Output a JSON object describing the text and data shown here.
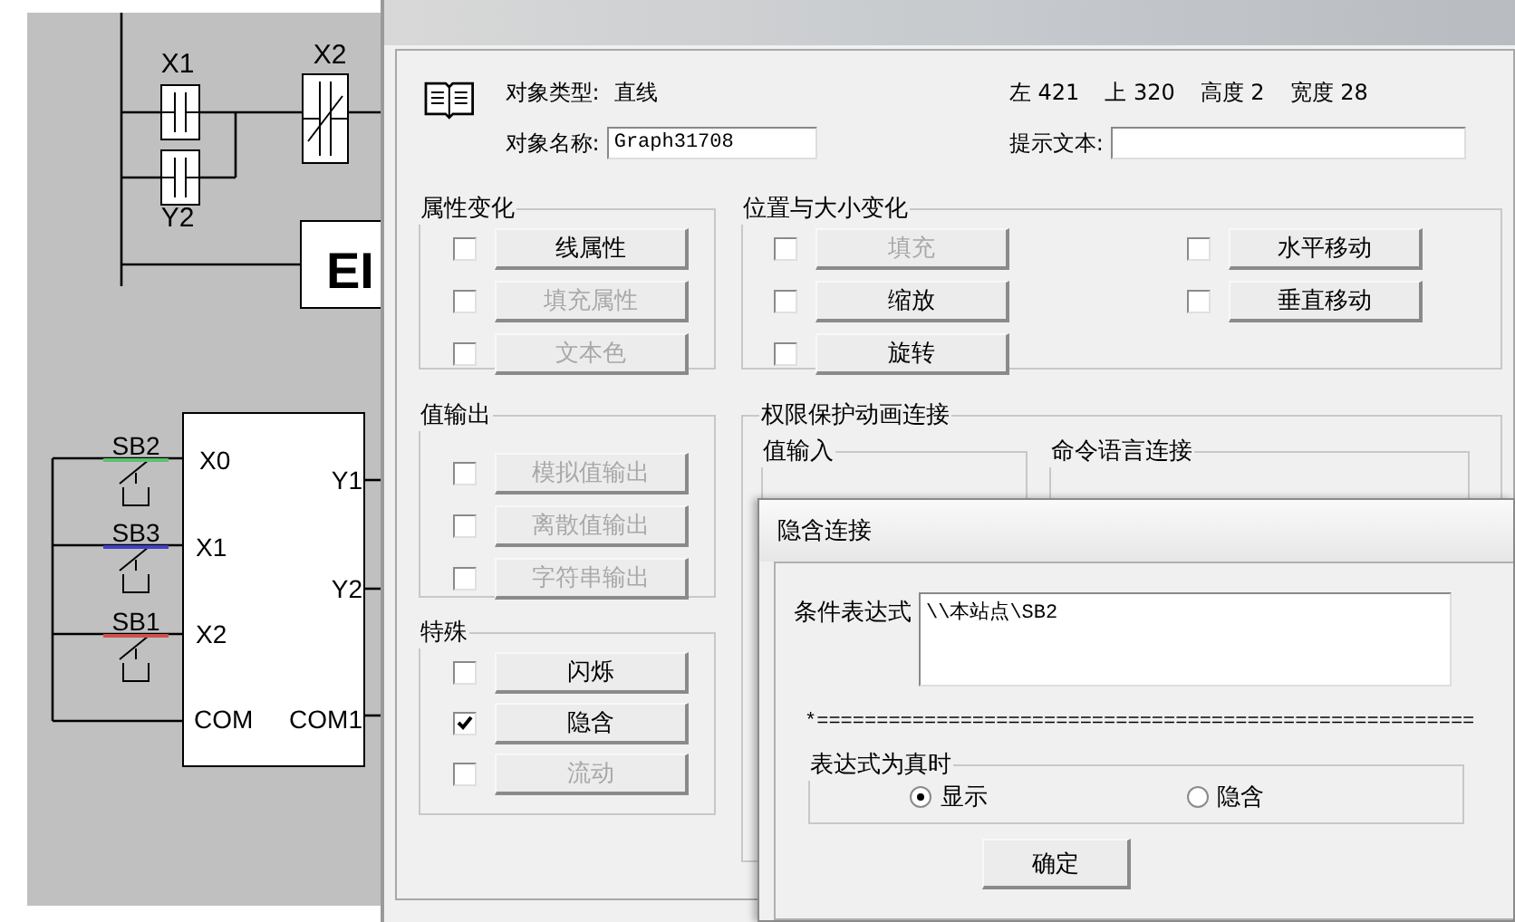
{
  "diagram": {
    "contacts": [
      {
        "label": "X1"
      },
      {
        "label": "Y2"
      },
      {
        "label": "X2"
      }
    ],
    "coil": "EI",
    "plc_inputs": [
      "X0",
      "X1",
      "X2",
      "COM"
    ],
    "plc_outputs": [
      "Y1",
      "Y2",
      "COM1"
    ],
    "switches": [
      {
        "label": "SB2",
        "color": "#5cc070"
      },
      {
        "label": "SB3",
        "color": "#4040c8"
      },
      {
        "label": "SB1",
        "color": "#d05050"
      }
    ]
  },
  "dialog": {
    "object_type_label": "对象类型:",
    "object_type": "直线",
    "object_name_label": "对象名称:",
    "object_name": "Graph31708",
    "geometry": [
      {
        "label": "左",
        "value": "421"
      },
      {
        "label": "上",
        "value": "320"
      },
      {
        "label": "高度",
        "value": "2"
      },
      {
        "label": "宽度",
        "value": "28"
      }
    ],
    "tooltip_label": "提示文本:",
    "attribute_group": {
      "title": "属性变化",
      "items": [
        {
          "label": "线属性",
          "checked": false,
          "disabled": false
        },
        {
          "label": "填充属性",
          "checked": false,
          "disabled": true
        },
        {
          "label": "文本色",
          "checked": false,
          "disabled": true
        }
      ]
    },
    "position_group": {
      "title": "位置与大小变化",
      "left_items": [
        {
          "label": "填充",
          "checked": false,
          "disabled": true
        },
        {
          "label": "缩放",
          "checked": false,
          "disabled": false
        },
        {
          "label": "旋转",
          "checked": false,
          "disabled": false
        }
      ],
      "right_items": [
        {
          "label": "水平移动",
          "checked": false,
          "disabled": false
        },
        {
          "label": "垂直移动",
          "checked": false,
          "disabled": false
        }
      ]
    },
    "value_output_group": {
      "title": "值输出",
      "items": [
        {
          "label": "模拟值输出",
          "checked": false,
          "disabled": true
        },
        {
          "label": "离散值输出",
          "checked": false,
          "disabled": true
        },
        {
          "label": "字符串输出",
          "checked": false,
          "disabled": true
        }
      ]
    },
    "special_group": {
      "title": "特殊",
      "items": [
        {
          "label": "闪烁",
          "checked": false,
          "disabled": false
        },
        {
          "label": "隐含",
          "checked": true,
          "disabled": false
        },
        {
          "label": "流动",
          "checked": false,
          "disabled": true
        }
      ]
    },
    "permission_group": {
      "title": "权限保护动画连接",
      "subgroups": [
        {
          "title": "值输入"
        },
        {
          "title": "命令语言连接"
        }
      ]
    }
  },
  "hide_dialog": {
    "title": "隐含连接",
    "condition_label": "条件表达式",
    "condition": "\\\\本站点\\SB2",
    "separator": "*=======================================================",
    "group_title": "表达式为真时",
    "options": [
      {
        "label": "显示",
        "selected": true
      },
      {
        "label": "隐含",
        "selected": false
      }
    ],
    "ok_button": "确定"
  }
}
